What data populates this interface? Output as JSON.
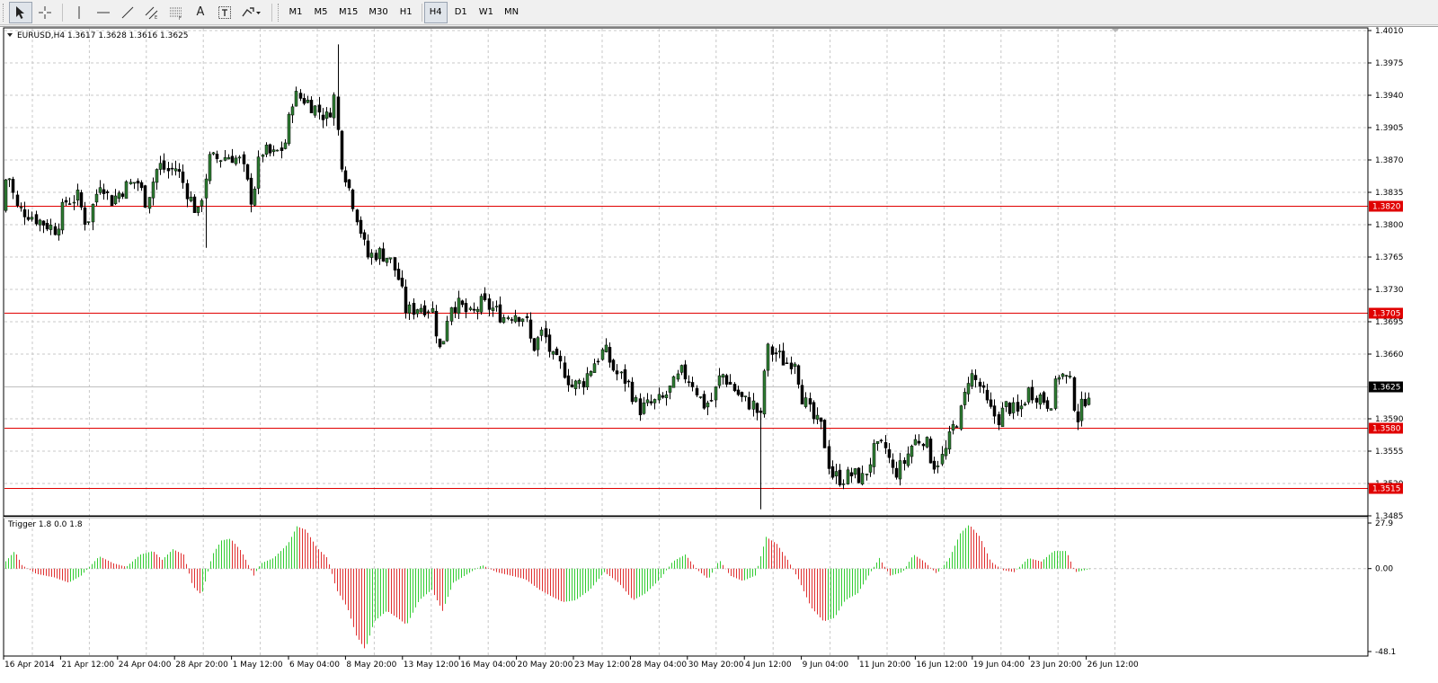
{
  "toolbar": {
    "tools": [
      {
        "name": "cursor-tool",
        "icon": "cursor-arrow-icon",
        "active": true
      },
      {
        "name": "crosshair-tool",
        "icon": "crosshair-icon",
        "active": false
      },
      {
        "name": "vertical-line-tool",
        "icon": "vertical-line-icon",
        "active": false
      },
      {
        "name": "horizontal-line-tool",
        "icon": "horizontal-line-icon",
        "active": false
      },
      {
        "name": "trendline-tool",
        "icon": "trendline-icon",
        "active": false
      },
      {
        "name": "equidistant-channel-tool",
        "icon": "channel-icon",
        "active": false
      },
      {
        "name": "fibonacci-retracement-tool",
        "icon": "fibonacci-icon",
        "active": false
      },
      {
        "name": "text-tool",
        "icon": "text-a-icon",
        "active": false
      },
      {
        "name": "text-label-tool",
        "icon": "text-label-icon",
        "active": false
      },
      {
        "name": "arrows-tool",
        "icon": "arrows-dropdown-icon",
        "active": false
      }
    ],
    "text_tool_glyph": "A",
    "timeframes": [
      "M1",
      "M5",
      "M15",
      "M30",
      "H1",
      "H4",
      "D1",
      "W1",
      "MN"
    ],
    "active_timeframe": "H4"
  },
  "chart": {
    "header": "EURUSD,H4  1.3617 1.3628 1.3616 1.3625",
    "indicator_header": "Trigger 1.8 0.0 1.8",
    "price_axis": [
      "1.4010",
      "1.3975",
      "1.3940",
      "1.3905",
      "1.3870",
      "1.3835",
      "1.3800",
      "1.3765",
      "1.3730",
      "1.3695",
      "1.3660",
      "1.3590",
      "1.3555",
      "1.3520",
      "1.3485"
    ],
    "indicator_axis": [
      "27.9",
      "0.00",
      "-48.1"
    ],
    "time_axis": [
      "16 Apr 2014",
      "21 Apr 12:00",
      "24 Apr 04:00",
      "28 Apr 20:00",
      "1 May 12:00",
      "6 May 04:00",
      "8 May 20:00",
      "13 May 12:00",
      "16 May 04:00",
      "20 May 20:00",
      "23 May 12:00",
      "28 May 04:00",
      "30 May 20:00",
      "4 Jun 12:00",
      "9 Jun 04:00",
      "11 Jun 20:00",
      "16 Jun 12:00",
      "19 Jun 04:00",
      "23 Jun 20:00",
      "26 Jun 12:00"
    ],
    "levels": [
      {
        "label": "1.3820",
        "value": 1.382
      },
      {
        "label": "1.3705",
        "value": 1.3705
      },
      {
        "label": "1.3580",
        "value": 1.358
      },
      {
        "label": "1.3515",
        "value": 1.3515
      }
    ],
    "current_price": {
      "label": "1.3625",
      "value": 1.3625
    },
    "colors": {
      "bull": "#2e7d32",
      "bear": "#000000",
      "level": "#e00000",
      "hist_pos": "#33cc33",
      "hist_neg": "#e03030",
      "grid": "#c8c8c8"
    }
  },
  "chart_data": {
    "type": "candlestick",
    "symbol": "EURUSD",
    "timeframe": "H4",
    "ylim": [
      1.3485,
      1.401
    ],
    "close_path": [
      [
        0,
        1.3815
      ],
      [
        8,
        1.386
      ],
      [
        18,
        1.3818
      ],
      [
        32,
        1.3812
      ],
      [
        42,
        1.3805
      ],
      [
        52,
        1.38
      ],
      [
        62,
        1.3795
      ],
      [
        72,
        1.3825
      ],
      [
        86,
        1.383
      ],
      [
        96,
        1.38
      ],
      [
        112,
        1.385
      ],
      [
        122,
        1.3825
      ],
      [
        138,
        1.384
      ],
      [
        152,
        1.3848
      ],
      [
        162,
        1.3825
      ],
      [
        176,
        1.3865
      ],
      [
        186,
        1.3858
      ],
      [
        196,
        1.3862
      ],
      [
        208,
        1.3835
      ],
      [
        220,
        1.381
      ],
      [
        232,
        1.387
      ],
      [
        244,
        1.3872
      ],
      [
        256,
        1.3875
      ],
      [
        268,
        1.3868
      ],
      [
        280,
        1.3825
      ],
      [
        290,
        1.388
      ],
      [
        304,
        1.3875
      ],
      [
        316,
        1.3885
      ],
      [
        326,
        1.394
      ],
      [
        340,
        1.3935
      ],
      [
        352,
        1.3925
      ],
      [
        364,
        1.3915
      ],
      [
        372,
        1.394
      ],
      [
        378,
        1.3875
      ],
      [
        388,
        1.384
      ],
      [
        398,
        1.3805
      ],
      [
        408,
        1.3765
      ],
      [
        420,
        1.377
      ],
      [
        432,
        1.3765
      ],
      [
        442,
        1.3745
      ],
      [
        452,
        1.3705
      ],
      [
        466,
        1.3712
      ],
      [
        480,
        1.371
      ],
      [
        490,
        1.366
      ],
      [
        500,
        1.3715
      ],
      [
        512,
        1.3712
      ],
      [
        524,
        1.37
      ],
      [
        534,
        1.3715
      ],
      [
        546,
        1.371
      ],
      [
        560,
        1.37
      ],
      [
        572,
        1.3705
      ],
      [
        584,
        1.37
      ],
      [
        592,
        1.3665
      ],
      [
        604,
        1.3685
      ],
      [
        614,
        1.3655
      ],
      [
        626,
        1.3645
      ],
      [
        636,
        1.3625
      ],
      [
        648,
        1.363
      ],
      [
        660,
        1.365
      ],
      [
        672,
        1.3665
      ],
      [
        684,
        1.364
      ],
      [
        698,
        1.363
      ],
      [
        710,
        1.36
      ],
      [
        722,
        1.3605
      ],
      [
        736,
        1.361
      ],
      [
        748,
        1.3625
      ],
      [
        758,
        1.364
      ],
      [
        770,
        1.363
      ],
      [
        782,
        1.3605
      ],
      [
        792,
        1.361
      ],
      [
        802,
        1.364
      ],
      [
        814,
        1.3625
      ],
      [
        826,
        1.361
      ],
      [
        838,
        1.3605
      ],
      [
        846,
        1.359
      ],
      [
        852,
        1.3665
      ],
      [
        864,
        1.366
      ],
      [
        874,
        1.365
      ],
      [
        884,
        1.3655
      ],
      [
        892,
        1.3615
      ],
      [
        904,
        1.359
      ],
      [
        914,
        1.358
      ],
      [
        924,
        1.353
      ],
      [
        936,
        1.3525
      ],
      [
        948,
        1.353
      ],
      [
        960,
        1.3525
      ],
      [
        972,
        1.3555
      ],
      [
        984,
        1.356
      ],
      [
        994,
        1.353
      ],
      [
        1004,
        1.354
      ],
      [
        1016,
        1.3565
      ],
      [
        1028,
        1.357
      ],
      [
        1038,
        1.354
      ],
      [
        1050,
        1.355
      ],
      [
        1060,
        1.358
      ],
      [
        1070,
        1.36
      ],
      [
        1078,
        1.364
      ],
      [
        1090,
        1.3625
      ],
      [
        1100,
        1.36
      ],
      [
        1110,
        1.359
      ],
      [
        1120,
        1.3605
      ],
      [
        1132,
        1.3595
      ],
      [
        1144,
        1.362
      ],
      [
        1156,
        1.3615
      ],
      [
        1168,
        1.3605
      ],
      [
        1178,
        1.364
      ],
      [
        1190,
        1.363
      ],
      [
        1198,
        1.359
      ],
      [
        1206,
        1.361
      ],
      [
        1214,
        1.3625
      ]
    ],
    "spikes": [
      {
        "x": 374,
        "high": 1.3995
      },
      {
        "x": 846,
        "low": 1.3492
      },
      {
        "x": 228,
        "low": 1.3775
      }
    ],
    "indicator": {
      "name": "Trigger",
      "ylim": [
        -48.1,
        27.9
      ],
      "histogram_path": [
        [
          4,
          3
        ],
        [
          16,
          10
        ],
        [
          24,
          2
        ],
        [
          40,
          -3
        ],
        [
          60,
          -5
        ],
        [
          76,
          -8
        ],
        [
          90,
          -4
        ],
        [
          110,
          7
        ],
        [
          126,
          3
        ],
        [
          140,
          1
        ],
        [
          156,
          8
        ],
        [
          170,
          10
        ],
        [
          180,
          5
        ],
        [
          192,
          11
        ],
        [
          204,
          8
        ],
        [
          214,
          -10
        ],
        [
          224,
          -15
        ],
        [
          236,
          8
        ],
        [
          246,
          16
        ],
        [
          256,
          17
        ],
        [
          268,
          10
        ],
        [
          282,
          -4
        ],
        [
          290,
          3
        ],
        [
          304,
          6
        ],
        [
          320,
          14
        ],
        [
          330,
          24
        ],
        [
          340,
          22
        ],
        [
          352,
          12
        ],
        [
          364,
          6
        ],
        [
          374,
          -12
        ],
        [
          386,
          -22
        ],
        [
          396,
          -38
        ],
        [
          406,
          -46
        ],
        [
          416,
          -30
        ],
        [
          430,
          -24
        ],
        [
          442,
          -28
        ],
        [
          452,
          -32
        ],
        [
          466,
          -18
        ],
        [
          480,
          -12
        ],
        [
          492,
          -24
        ],
        [
          504,
          -8
        ],
        [
          520,
          -3
        ],
        [
          536,
          2
        ],
        [
          552,
          -2
        ],
        [
          568,
          -4
        ],
        [
          584,
          -6
        ],
        [
          600,
          -12
        ],
        [
          614,
          -16
        ],
        [
          626,
          -19
        ],
        [
          640,
          -18
        ],
        [
          656,
          -12
        ],
        [
          672,
          -2
        ],
        [
          688,
          -8
        ],
        [
          704,
          -18
        ],
        [
          718,
          -14
        ],
        [
          734,
          -6
        ],
        [
          748,
          4
        ],
        [
          762,
          8
        ],
        [
          776,
          -1
        ],
        [
          788,
          -6
        ],
        [
          800,
          5
        ],
        [
          812,
          -4
        ],
        [
          826,
          -7
        ],
        [
          840,
          -4
        ],
        [
          852,
          18
        ],
        [
          864,
          14
        ],
        [
          876,
          5
        ],
        [
          888,
          -6
        ],
        [
          902,
          -22
        ],
        [
          916,
          -30
        ],
        [
          928,
          -28
        ],
        [
          940,
          -18
        ],
        [
          954,
          -14
        ],
        [
          966,
          -4
        ],
        [
          978,
          6
        ],
        [
          990,
          -4
        ],
        [
          1004,
          -2
        ],
        [
          1016,
          8
        ],
        [
          1028,
          4
        ],
        [
          1042,
          -3
        ],
        [
          1056,
          6
        ],
        [
          1068,
          20
        ],
        [
          1078,
          25
        ],
        [
          1090,
          18
        ],
        [
          1102,
          4
        ],
        [
          1116,
          -1
        ],
        [
          1128,
          -2
        ],
        [
          1144,
          6
        ],
        [
          1158,
          4
        ],
        [
          1172,
          10
        ],
        [
          1186,
          10
        ],
        [
          1196,
          -2
        ],
        [
          1206,
          -1
        ],
        [
          1214,
          0
        ]
      ]
    }
  }
}
